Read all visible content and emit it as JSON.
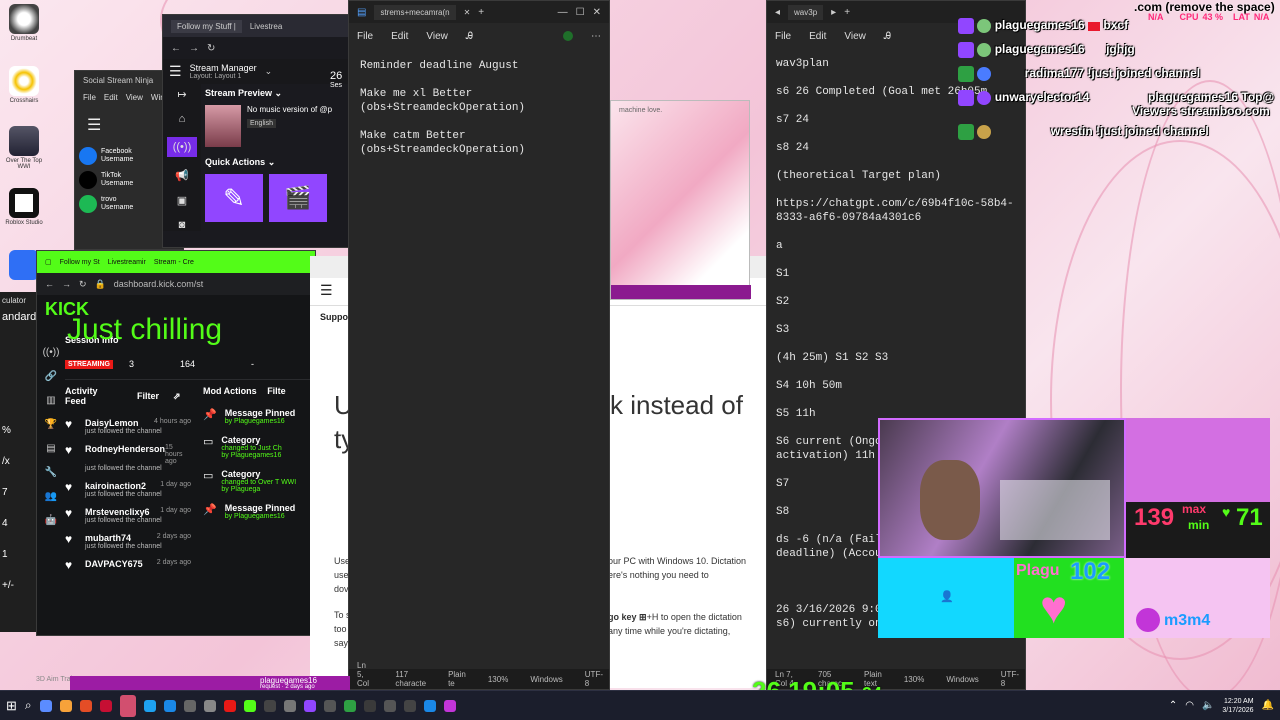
{
  "desktop": {
    "icons": [
      "Drumbeat",
      "Crosshairs",
      "Over The Top WWI",
      "Roblox Studio",
      "Roblox Player"
    ]
  },
  "ssn": {
    "title": "Social Stream Ninja",
    "menu": [
      "File",
      "Edit",
      "View",
      "Window"
    ],
    "platforms": [
      {
        "name": "Facebook",
        "sub": "Username",
        "color": "#1877f2"
      },
      {
        "name": "TikTok",
        "sub": "Username",
        "color": "#000000"
      },
      {
        "name": "trovo",
        "sub": "Username",
        "color": "#1db954"
      }
    ]
  },
  "streamdeck": {
    "title": "Stream Manager",
    "layout": "Layout: Layout 1",
    "preview_label": "Stream Preview",
    "preview_title": "No music version of @p",
    "preview_lang": "English",
    "quick_actions": "Quick Actions",
    "tabs": [
      "Follow my Stuff |",
      "Livestrea"
    ],
    "counter": "26",
    "counter_sub": "Ses"
  },
  "kick": {
    "tabs": [
      "Follow my St",
      "Livestreamir",
      "Stream - Cre"
    ],
    "url": "dashboard.kick.com/st",
    "logo": "KICK",
    "stream_title": "Just chilling",
    "session_info": "Session Info",
    "streaming_badge": "STREAMING",
    "stats": [
      "3",
      "164",
      "-"
    ],
    "activity_title": "Activity Feed",
    "filter_label": "Filter",
    "mod_title": "Mod Actions",
    "mod_filter": "Filte",
    "feed": [
      {
        "name": "DaisyLemon",
        "time": "4 hours ago",
        "sub": "just followed the channel"
      },
      {
        "name": "RodneyHenderson",
        "time": "15 hours ago",
        "sub": "just followed the channel"
      },
      {
        "name": "kairoinaction2",
        "time": "1 day ago",
        "sub": "just followed the channel"
      },
      {
        "name": "Mrstevenclixy6",
        "time": "1 day ago",
        "sub": "just followed the channel"
      },
      {
        "name": "mubarth74",
        "time": "2 days ago",
        "sub": "just followed the channel"
      },
      {
        "name": "DAVPACY675",
        "time": "2 days ago",
        "sub": ""
      }
    ],
    "mod_actions": [
      {
        "title": "Message Pinned",
        "detail": "",
        "by": "by Plaguegames16"
      },
      {
        "title": "Category",
        "detail": "changed to Just Ch",
        "by": "by Plaguegames16"
      },
      {
        "title": "Category",
        "detail": "changed to Over T WWI",
        "by": "by Plaguega"
      },
      {
        "title": "Message Pinned",
        "detail": "",
        "by": "by Plaguegames16"
      }
    ]
  },
  "left_calc": {
    "label": "culator",
    "standard": "andard",
    "rows": [
      "%",
      "/x",
      "7",
      "4",
      "1",
      "+/-"
    ]
  },
  "notepad1": {
    "tab": "strems+mecamra(n",
    "menu": [
      "File",
      "Edit",
      "View"
    ],
    "lines": [
      "Reminder deadline August",
      "",
      "Make me xl Better",
      "(obs+StreamdeckOperation)",
      "",
      "Make catm Better",
      "(obs+StreamdeckOperation)"
    ],
    "status": [
      "Ln 5, Col 43",
      "117 characte",
      "Plain te",
      "130%",
      "Windows",
      "UTF-8"
    ]
  },
  "notepad2": {
    "tab": "wav3p",
    "menu": [
      "File",
      "Edit",
      "View"
    ],
    "lines": [
      "wav3plan",
      "",
      "s6 26 Completed (Goal met 26h05m",
      "",
      "s7 24",
      "",
      "s8 24",
      "",
      "(theoretical Target plan)",
      "",
      "https://chatgpt.com/c/69b4f10c-58b4-",
      "8333-a6f6-09784a4301c6",
      "",
      "a",
      "",
      "S1",
      "",
      "S2",
      "",
      "S3",
      "",
      "(4h 25m) S1 S2 S3",
      "",
      "S4 10h 50m",
      "",
      "S5 11h",
      "",
      "S6 current (Ongo",
      "activation) 11h",
      "",
      "S7",
      "",
      "S8",
      "",
      "ds -6 (n/a (Fail",
      "deadline) (Accou",
      "",
      "",
      "",
      "26 3/16/2026 9:0",
      "s6) currently on"
    ],
    "status": [
      "Ln 7, Col 4",
      "705 charac",
      "Plain text",
      "130%",
      "Windows",
      "UTF-8"
    ]
  },
  "browser_article": {
    "support": "Suppo",
    "heading_1": "U",
    "heading_frag": "k instead of",
    "heading_2": "ty",
    "para_frag_1": "our PC with Windows 10. Dictation",
    "para_frag_2": "ere's nothing you need to",
    "left_frag": [
      "Use",
      "use",
      "dov",
      "To s",
      "too",
      "say"
    ],
    "key_text": "go key",
    "key_combo": "+H to open the dictation",
    "para_frag_3": "any time while you're dictating,"
  },
  "overlay": {
    "top_note": ".com (remove the space)",
    "cpu": "CPU",
    "cpu_val": "43 %",
    "lat": "LAT",
    "lat_val": "N/A",
    "na_top": "N/A",
    "chat": [
      {
        "user": "plaguegames16",
        "msg": "bxcf"
      },
      {
        "user": "plaguegames16",
        "msg": "jghjg"
      },
      {
        "user": "radima177",
        "msg": "!just joined channel"
      },
      {
        "user": "unwaryelector14",
        "msg": ""
      },
      {
        "user": "wrestin",
        "msg": "!just joined channel"
      }
    ],
    "top_banner_1": "plaguegames16 Top@",
    "top_banner_2": "Viewers streamboo.com",
    "clock": "26.19:05.",
    "clock_ms": "24",
    "hr_max": "max",
    "hr_min": "min",
    "hr_cur": "139",
    "hr_min_val": "71",
    "plague_label": "Plagu",
    "plague_num": "102",
    "m3m4": "m3m4"
  },
  "taskbar": {
    "time": "12:20 AM",
    "date": "3/17/2026",
    "bottom_user": "plaguegames16",
    "bottom_sub": "request · 2 days ago",
    "aim_label": "3D Aim Trainer"
  }
}
